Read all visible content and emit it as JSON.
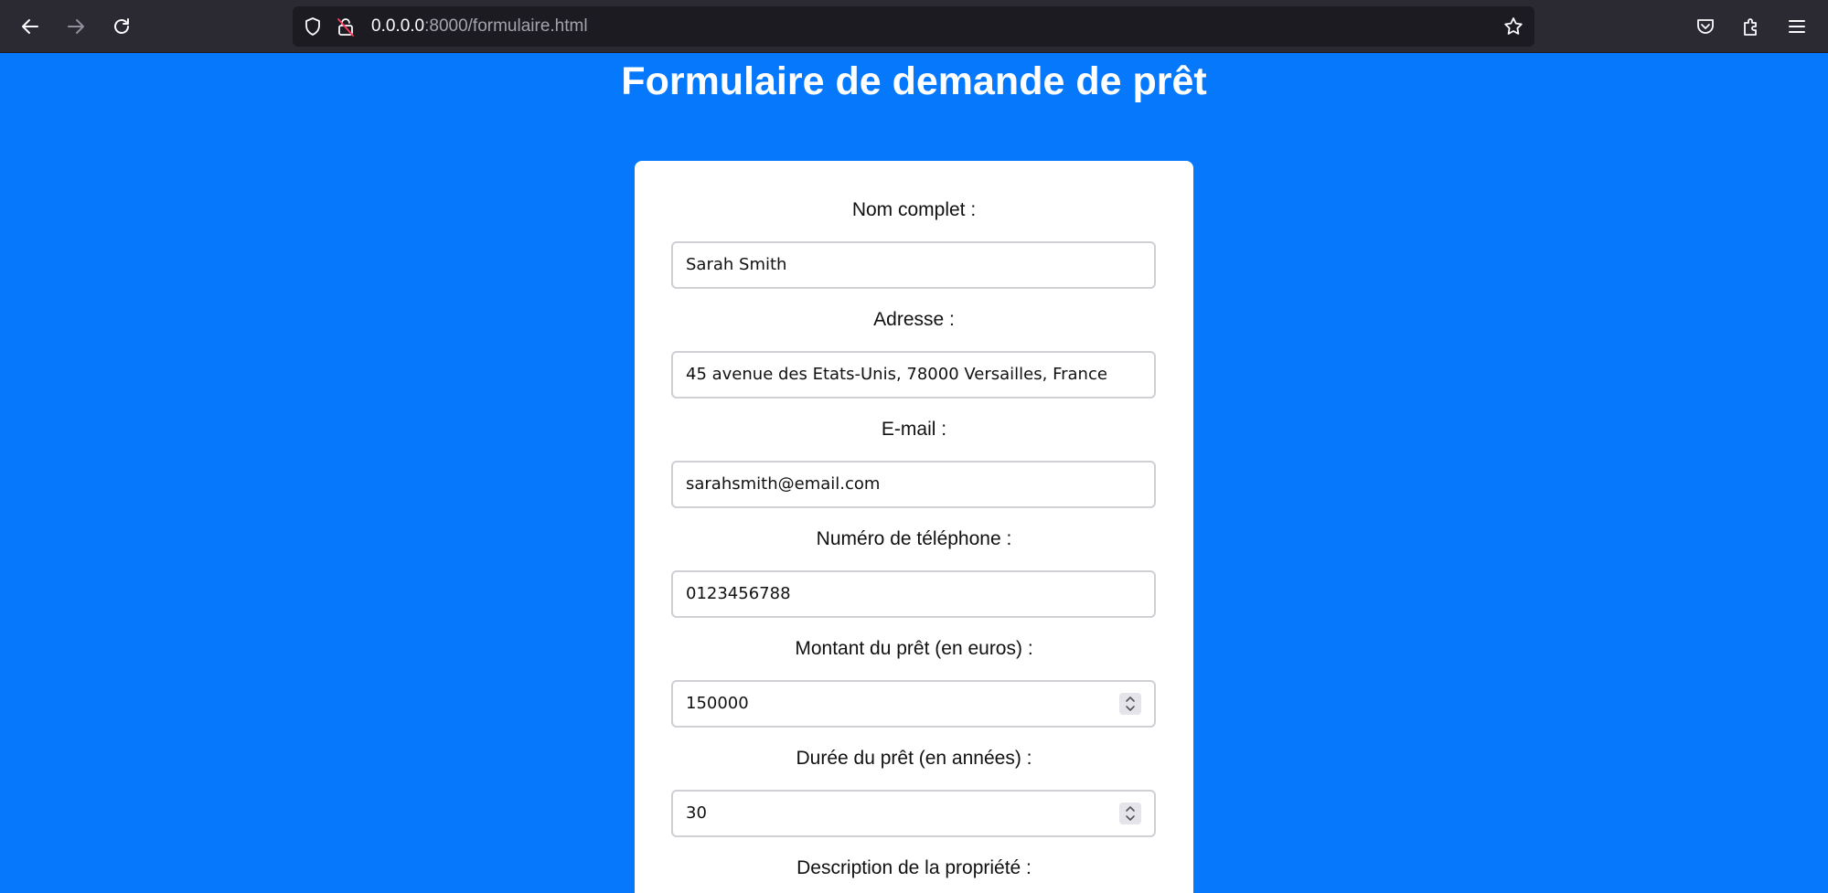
{
  "browser": {
    "url_host": "0.0.0.0",
    "url_path": ":8000/formulaire.html",
    "icons": [
      "back-icon",
      "forward-icon",
      "reload-icon",
      "shield-icon",
      "insecure-lock-icon",
      "bookmark-star-icon",
      "pocket-icon",
      "extensions-icon",
      "menu-icon"
    ]
  },
  "page": {
    "title": "Formulaire de demande de prêt"
  },
  "form": {
    "fields": [
      {
        "label": "Nom complet :",
        "value": "Sarah Smith"
      },
      {
        "label": "Adresse :",
        "value": "45 avenue des Etats-Unis, 78000 Versailles, France"
      },
      {
        "label": "E-mail :",
        "value": "sarahsmith@email.com"
      },
      {
        "label": "Numéro de téléphone :",
        "value": "0123456788"
      },
      {
        "label": "Montant du prêt (en euros) :",
        "value": "150000"
      },
      {
        "label": "Durée du prêt (en années) :",
        "value": "30"
      },
      {
        "label": "Description de la propriété :",
        "value": ""
      }
    ]
  },
  "colors": {
    "page_background": "#0578fb",
    "browser_chrome": "#2b2a33",
    "card_background": "#ffffff"
  }
}
